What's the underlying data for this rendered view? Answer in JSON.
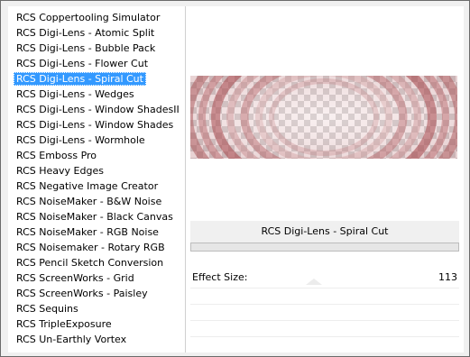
{
  "filters": {
    "items": [
      "RCS Coppertooling Simulator",
      "RCS Digi-Lens - Atomic Split",
      "RCS Digi-Lens - Bubble Pack",
      "RCS Digi-Lens - Flower Cut",
      "RCS Digi-Lens - Spiral Cut",
      "RCS Digi-Lens - Wedges",
      "RCS Digi-Lens - Window ShadesII",
      "RCS Digi-Lens - Window Shades",
      "RCS Digi-Lens - Wormhole",
      "RCS Emboss Pro",
      "RCS Heavy Edges",
      "RCS Negative Image Creator",
      "RCS NoiseMaker - B&W Noise",
      "RCS NoiseMaker - Black Canvas",
      "RCS NoiseMaker - RGB Noise",
      "RCS Noisemaker - Rotary RGB",
      "RCS Pencil Sketch Conversion",
      "RCS ScreenWorks - Grid",
      "RCS ScreenWorks - Paisley",
      "RCS Sequins",
      "RCS TripleExposure",
      "RCS Un-Earthly Vortex"
    ],
    "selected_index": 4,
    "selection_color": "#3399ff"
  },
  "effect": {
    "title": "RCS Digi-Lens - Spiral Cut",
    "parameters": [
      {
        "label": "Effect Size:",
        "value": "113"
      }
    ]
  },
  "preview": {
    "icon": "spiral-cut-preview",
    "tint": "#b05a5e"
  }
}
